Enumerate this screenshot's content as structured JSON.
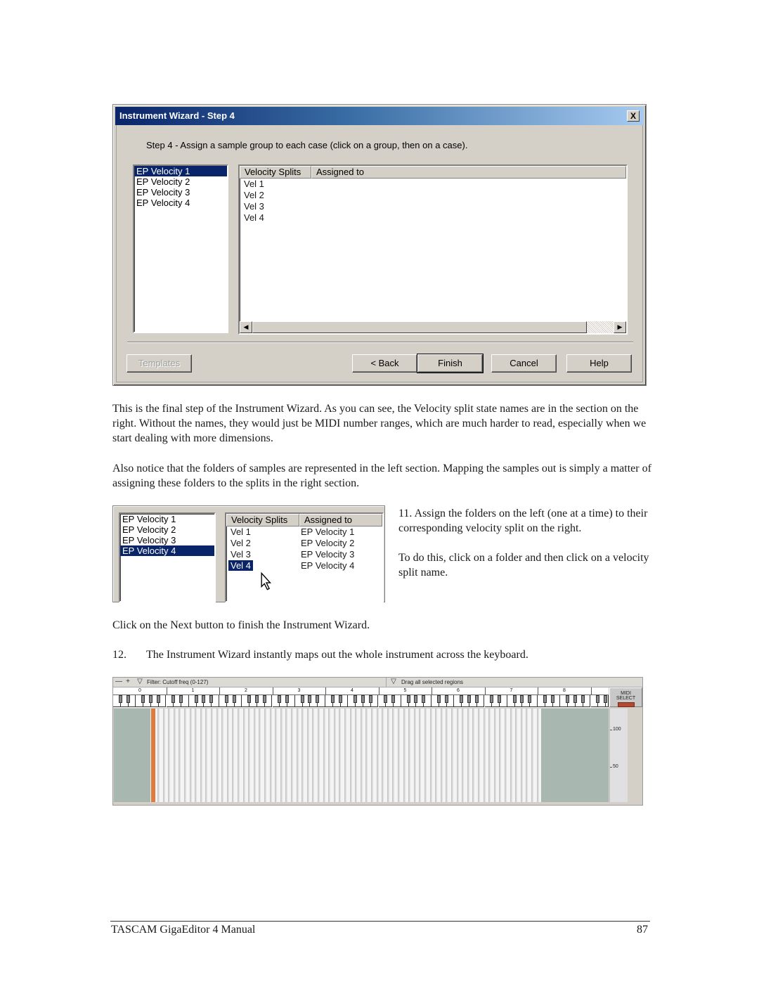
{
  "wizard": {
    "title": "Instrument Wizard - Step 4",
    "close_label": "X",
    "instruction": "Step 4 - Assign a sample group to each case (click on a group, then on a case).",
    "groups": [
      {
        "label": "EP Velocity 1",
        "selected": true
      },
      {
        "label": "EP Velocity 2",
        "selected": false
      },
      {
        "label": "EP Velocity 3",
        "selected": false
      },
      {
        "label": "EP Velocity 4",
        "selected": false
      }
    ],
    "columns": [
      "Velocity Splits",
      "Assigned to"
    ],
    "rows": [
      {
        "split": "Vel 1",
        "assigned": ""
      },
      {
        "split": "Vel 2",
        "assigned": ""
      },
      {
        "split": "Vel 3",
        "assigned": ""
      },
      {
        "split": "Vel 4",
        "assigned": ""
      }
    ],
    "scroll_left_icon": "◀",
    "scroll_right_icon": "▶",
    "buttons": {
      "templates": "Templates",
      "back": "< Back",
      "finish": "Finish",
      "cancel": "Cancel",
      "help": "Help"
    }
  },
  "text": {
    "p1": "This is the final step of the Instrument Wizard.  As you can see, the Velocity split state names are in the section on the right.  Without the names, they would just be MIDI number ranges, which are much harder to read, especially when we start dealing with more dimensions.",
    "p2": "Also notice that the folders of samples are represented in the left section. Mapping the samples out is simply a matter of assigning these folders to the splits in the right section.",
    "side1": "11. Assign the folders on the left (one at a time) to their corresponding velocity split on the right.",
    "side2": "To do this, click on a folder and then click on a velocity split name.",
    "p3": "Click on the Next button to finish the Instrument Wizard.",
    "p4_num": "12.",
    "p4": "The Instrument Wizard instantly maps out the whole instrument across the keyboard."
  },
  "assign": {
    "groups": [
      {
        "label": "EP Velocity 1",
        "selected": false
      },
      {
        "label": "EP Velocity 2",
        "selected": false
      },
      {
        "label": "EP Velocity 3",
        "selected": false
      },
      {
        "label": "EP Velocity 4",
        "selected": true
      }
    ],
    "columns": [
      "Velocity Splits",
      "Assigned to"
    ],
    "rows": [
      {
        "split": "Vel 1",
        "assigned": "EP Velocity 1",
        "selected": false
      },
      {
        "split": "Vel 2",
        "assigned": "EP Velocity 2",
        "selected": false
      },
      {
        "split": "Vel 3",
        "assigned": "EP Velocity 3",
        "selected": false
      },
      {
        "split": "Vel 4",
        "assigned": "EP Velocity 4",
        "selected": true
      }
    ],
    "cursor_icon": "arrow-pointer"
  },
  "editor": {
    "minus_icon": "—",
    "plus_icon": "+",
    "dropdown_icon": "▽",
    "filter_label": "Filter: Cutoff freq (0-127)",
    "drag_label": "Drag all selected regions",
    "octaves": [
      "0",
      "1",
      "2",
      "3",
      "4",
      "5",
      "6",
      "7",
      "8"
    ],
    "midi_select_line1": "MIDI",
    "midi_select_line2": "SELECT",
    "scale_labels": [
      "100",
      "50"
    ],
    "colors": {
      "empty_region": "#a8b8b0",
      "marker": "#e07b3c",
      "led": "#b04a30"
    }
  },
  "footer": {
    "left": "TASCAM GigaEditor 4 Manual",
    "page": "87"
  }
}
